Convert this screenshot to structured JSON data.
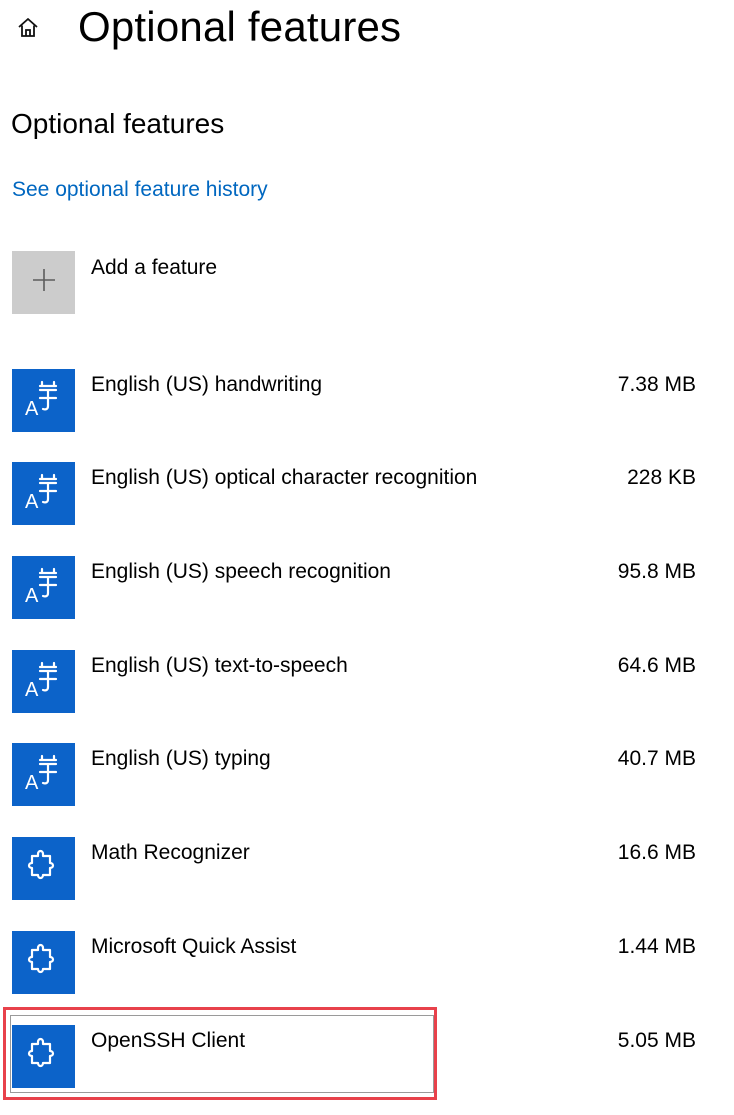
{
  "header": {
    "title": "Optional features",
    "home_icon": "home-icon"
  },
  "section": {
    "title": "Optional features",
    "history_link": "See optional feature history"
  },
  "add_feature": {
    "label": "Add a feature",
    "icon": "plus-icon"
  },
  "features": [
    {
      "name": "English (US) handwriting",
      "size": "7.38 MB",
      "icon": "language-icon"
    },
    {
      "name": "English (US) optical character recognition",
      "size": "228 KB",
      "icon": "language-icon"
    },
    {
      "name": "English (US) speech recognition",
      "size": "95.8 MB",
      "icon": "language-icon"
    },
    {
      "name": "English (US) text-to-speech",
      "size": "64.6 MB",
      "icon": "language-icon"
    },
    {
      "name": "English (US) typing",
      "size": "40.7 MB",
      "icon": "language-icon"
    },
    {
      "name": "Math Recognizer",
      "size": "16.6 MB",
      "icon": "puzzle-icon"
    },
    {
      "name": "Microsoft Quick Assist",
      "size": "1.44 MB",
      "icon": "puzzle-icon"
    },
    {
      "name": "OpenSSH Client",
      "size": "5.05 MB",
      "icon": "puzzle-icon",
      "highlighted": true
    }
  ],
  "colors": {
    "accent": "#0c63c9",
    "link": "#0067c0",
    "highlight": "#e8414b",
    "add_tile": "#cccccc"
  }
}
